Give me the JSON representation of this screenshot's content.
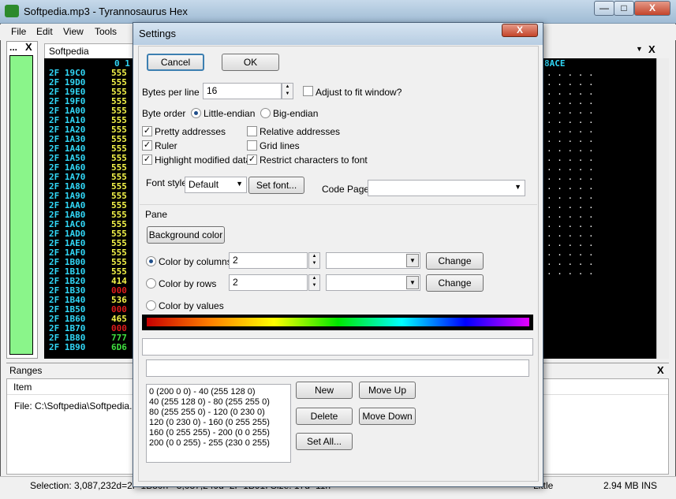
{
  "window": {
    "title": "Softpedia.mp3 - Tyrannosaurus Hex",
    "min": "—",
    "max": "□",
    "close": "X"
  },
  "menu": [
    "File",
    "Edit",
    "View",
    "Tools"
  ],
  "side_panel": {
    "label": "...",
    "close": "X"
  },
  "hex": {
    "tab": "Softpedia beep.mp3",
    "ruler_left": "0 1",
    "ruler_right": "8ACE",
    "addresses": [
      "2F 19C0",
      "2F 19D0",
      "2F 19E0",
      "2F 19F0",
      "2F 1A00",
      "2F 1A10",
      "2F 1A20",
      "2F 1A30",
      "2F 1A40",
      "2F 1A50",
      "2F 1A60",
      "2F 1A70",
      "2F 1A80",
      "2F 1A90",
      "2F 1AA0",
      "2F 1AB0",
      "2F 1AC0",
      "2F 1AD0",
      "2F 1AE0",
      "2F 1AF0",
      "2F 1B00",
      "2F 1B10",
      "2F 1B20",
      "2F 1B30",
      "2F 1B40",
      "2F 1B50",
      "2F 1B60",
      "2F 1B70",
      "2F 1B80",
      "2F 1B90"
    ],
    "bytes": [
      "555",
      "555",
      "555",
      "555",
      "555",
      "555",
      "555",
      "555",
      "555",
      "555",
      "555",
      "555",
      "555",
      "555",
      "555",
      "555",
      "555",
      "555",
      "555",
      "555",
      "555",
      "555",
      "414",
      "000",
      "536",
      "000",
      "465",
      "000",
      "777",
      "6D6"
    ],
    "ascii": [
      ". . . . .",
      ". . . . .",
      ". . . . .",
      ". . . . .",
      ". . . . .",
      ". . . . .",
      ". . . . .",
      ". . . . .",
      ". . . . .",
      ". . . . .",
      ". . . . .",
      ". . . . .",
      ". . . . .",
      ". . . . .",
      ". . . . .",
      ". . . . .",
      ". . . . .",
      ". . . . .",
      ". . . . .",
      ". . . . .",
      ". . . . .",
      ". . . . ."
    ]
  },
  "ranges": {
    "title": "Ranges",
    "close": "X",
    "column": "Item",
    "row": "File: C:\\Softpedia\\Softpedia.m"
  },
  "status": {
    "selection": "Selection: 3,087,232d=2F 1B80h - 3,087,249d=2F 1B91I Size: 17d=11h",
    "endian": "Little",
    "size": "2.94 MB INS"
  },
  "dialog": {
    "title": "Settings",
    "close": "X",
    "cancel": "Cancel",
    "ok": "OK",
    "bytes_per_line_label": "Bytes per line",
    "bytes_per_line_value": "16",
    "adjust_label": "Adjust to fit window?",
    "byte_order_label": "Byte order",
    "little_endian": "Little-endian",
    "big_endian": "Big-endian",
    "pretty_addresses": "Pretty addresses",
    "relative_addresses": "Relative addresses",
    "ruler": "Ruler",
    "grid_lines": "Grid lines",
    "highlight_modified": "Highlight modified data",
    "restrict_chars": "Restrict characters to font",
    "font_style_label": "Font style",
    "font_style_value": "Default",
    "set_font": "Set font...",
    "code_page_label": "Code Page",
    "code_page_value": "",
    "pane_label": "Pane",
    "background_color": "Background color",
    "color_by_columns": "Color by columns",
    "color_by_columns_value": "2",
    "color_by_rows": "Color by rows",
    "color_by_rows_value": "2",
    "color_by_values": "Color by values",
    "change": "Change",
    "color_ranges": [
      "0 (200 0 0) - 40 (255 128 0)",
      "40 (255 128 0) - 80 (255 255 0)",
      "80 (255 255 0) - 120 (0 230 0)",
      "120 (0 230 0) - 160 (0 255 255)",
      "160 (0 255 255) - 200 (0 0 255)",
      "200 (0 0 255) - 255 (230 0 255)"
    ],
    "new": "New",
    "move_up": "Move Up",
    "delete": "Delete",
    "move_down": "Move Down",
    "set_all": "Set All..."
  },
  "colors": {
    "address": "#31d7f7",
    "bytes": "#f7f74a",
    "hex_bg": "#000000",
    "green_bar": "#8af58a"
  }
}
